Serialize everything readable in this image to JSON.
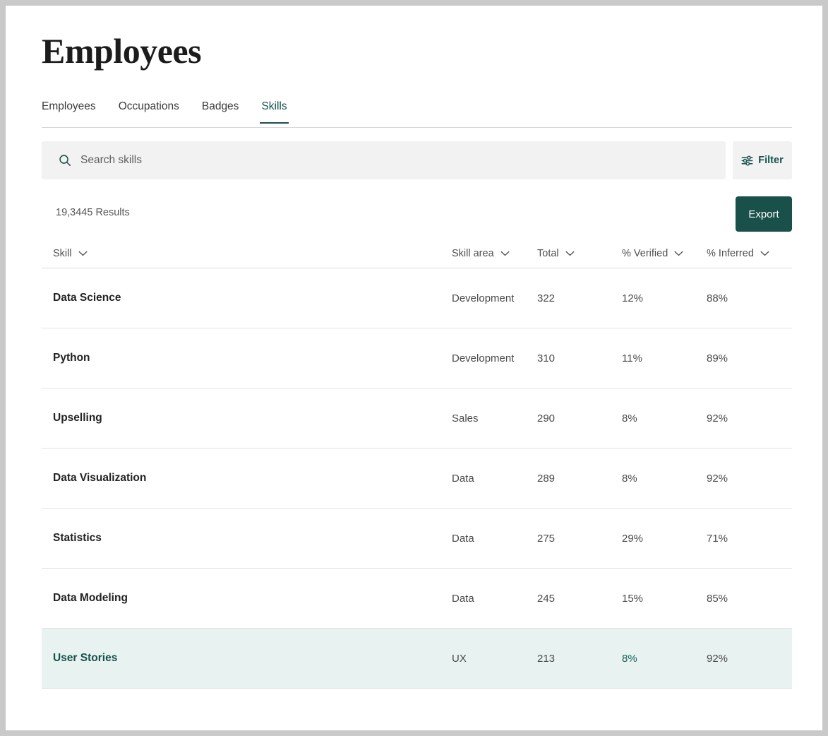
{
  "header": {
    "title": "Employees"
  },
  "tabs": [
    {
      "label": "Employees",
      "active": false
    },
    {
      "label": "Occupations",
      "active": false
    },
    {
      "label": "Badges",
      "active": false
    },
    {
      "label": "Skills",
      "active": true
    }
  ],
  "search": {
    "placeholder": "Search skills",
    "value": "",
    "icon": "search-icon"
  },
  "filter": {
    "label": "Filter",
    "icon": "sliders-icon"
  },
  "toolbar": {
    "results_text": "19,3445 Results",
    "export_label": "Export"
  },
  "table": {
    "columns": [
      {
        "label": "Skill",
        "sort_icon": "chevron-down-icon"
      },
      {
        "label": "Skill area",
        "sort_icon": "chevron-down-icon"
      },
      {
        "label": "Total",
        "sort_icon": "chevron-down-icon"
      },
      {
        "label": "% Verified",
        "sort_icon": "chevron-down-icon"
      },
      {
        "label": "% Inferred",
        "sort_icon": "chevron-down-icon"
      }
    ],
    "rows": [
      {
        "skill": "Data Science",
        "area": "Development",
        "total": "322",
        "verified": "12%",
        "inferred": "88%",
        "highlight": false
      },
      {
        "skill": "Python",
        "area": "Development",
        "total": "310",
        "verified": "11%",
        "inferred": "89%",
        "highlight": false
      },
      {
        "skill": "Upselling",
        "area": "Sales",
        "total": "290",
        "verified": "8%",
        "inferred": "92%",
        "highlight": false
      },
      {
        "skill": "Data Visualization",
        "area": "Data",
        "total": "289",
        "verified": "8%",
        "inferred": "92%",
        "highlight": false
      },
      {
        "skill": "Statistics",
        "area": "Data",
        "total": "275",
        "verified": "29%",
        "inferred": "71%",
        "highlight": false
      },
      {
        "skill": "Data Modeling",
        "area": "Data",
        "total": "245",
        "verified": "15%",
        "inferred": "85%",
        "highlight": false
      },
      {
        "skill": "User Stories",
        "area": "UX",
        "total": "213",
        "verified": "8%",
        "inferred": "92%",
        "highlight": true
      }
    ]
  },
  "colors": {
    "accent_dark": "#1a504a",
    "accent_text": "#13524c",
    "row_highlight_bg": "#e8f2f0",
    "page_bg": "#c9c9c9",
    "field_bg": "#f2f2f2"
  }
}
